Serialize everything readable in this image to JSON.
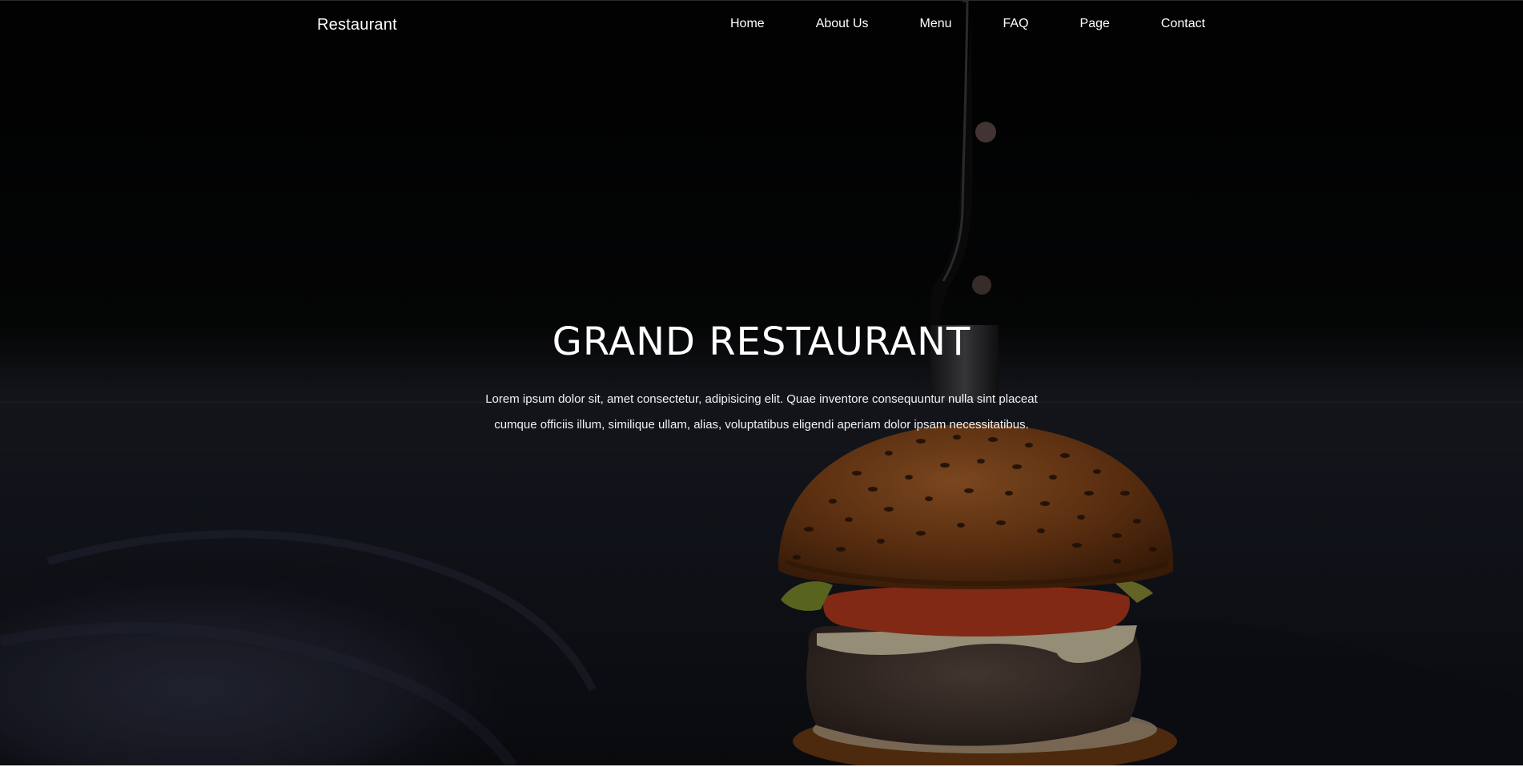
{
  "nav": {
    "brand": "Restaurant",
    "links": [
      "Home",
      "About Us",
      "Menu",
      "FAQ",
      "Page",
      "Contact"
    ]
  },
  "hero": {
    "title": "GRAND RESTAURANT",
    "description": "Lorem ipsum dolor sit, amet consectetur, adipisicing elit. Quae inventore consequuntur nulla sint placeat cumque officiis illum, similique ullam, alias, voluptatibus eligendi aperiam dolor ipsam necessitatibus."
  },
  "colors": {
    "background": "#020202",
    "text": "#ffffff",
    "bun": "#8a4a1c",
    "tomato": "#b83a1f",
    "patty": "#4a3a33",
    "cloth": "#2a2c3a"
  }
}
